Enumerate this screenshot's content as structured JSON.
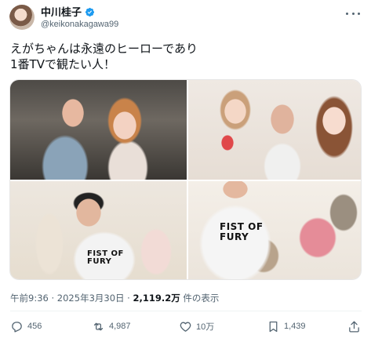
{
  "user": {
    "display_name": "中川桂子",
    "handle": "@keikonakagawa99",
    "verified": true,
    "verified_color": "#1d9bf0"
  },
  "tweet": {
    "lines": [
      "えがちゃんは永遠のヒーローであり",
      "1番TVで観たい人！"
    ]
  },
  "media": {
    "count": 4,
    "shirt_text": [
      "FIST OF",
      "FURY"
    ]
  },
  "meta": {
    "time": "午前9:36",
    "separator": "·",
    "date": "2025年3月30日",
    "views": "2,119.2万",
    "views_label": "件の表示"
  },
  "actions": {
    "replies": "456",
    "reposts": "4,987",
    "likes": "10万",
    "bookmarks": "1,439"
  },
  "icons": {
    "more": "more-icon",
    "reply": "reply-icon",
    "repost": "repost-icon",
    "like": "heart-icon",
    "bookmark": "bookmark-icon",
    "share": "share-icon"
  }
}
